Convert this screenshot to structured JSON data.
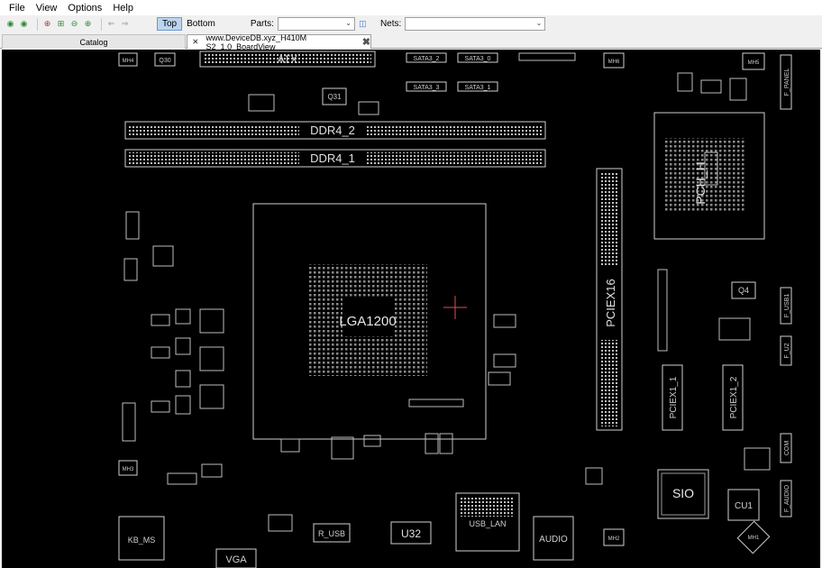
{
  "menu": [
    "File",
    "View",
    "Options",
    "Help"
  ],
  "toolbar": {
    "side_top": "Top",
    "side_bottom": "Bottom",
    "parts_label": "Parts:",
    "nets_label": "Nets:",
    "parts_value": "",
    "nets_value": ""
  },
  "tabs": {
    "catalog": "Catalog",
    "board": "www.DeviceDB.xyz_H410M S2_1.0_BoardView"
  },
  "board": {
    "labels": {
      "atx": "ATX",
      "ddr2": "DDR4_2",
      "ddr1": "DDR4_1",
      "sata2": "SATA3_2",
      "sata0": "SATA3_0",
      "sata3": "SATA3_3",
      "sata1": "SATA3_1",
      "cpu": "LGA1200",
      "pcie16": "PCIEX16",
      "pciex1_1": "PCIEX1_1",
      "pciex1_2": "PCIEX1_2",
      "pch": "PCH_H",
      "sio": "SIO",
      "cu1": "CU1",
      "q4": "Q4",
      "q31": "Q31",
      "q30": "Q30",
      "kbms": "KB_MS",
      "vga": "VGA",
      "r_usb": "R_USB",
      "u32": "U32",
      "usb_lan": "USB_LAN",
      "audio": "AUDIO",
      "f_panel": "F_PANEL",
      "f_usb1": "F_USB1",
      "f_audio": "F_AUDIO",
      "com": "COM",
      "f_u2": "F_U2",
      "mh4": "MH4",
      "mh3": "MH3",
      "mh2": "MH2",
      "mh6": "MH6",
      "mh5": "MH5",
      "mh1": "MH1"
    }
  }
}
